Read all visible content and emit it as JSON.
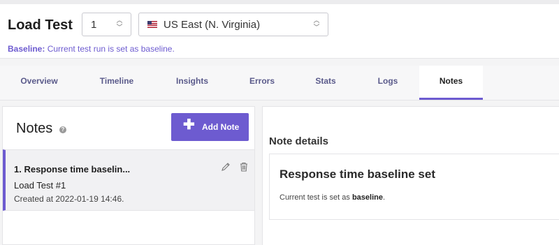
{
  "header": {
    "title": "Load Test",
    "run_value": "1",
    "region_value": "US East (N. Virginia)",
    "baseline_label": "Baseline:",
    "baseline_text": "Current test run is set as baseline."
  },
  "tabs": [
    {
      "label": "Overview"
    },
    {
      "label": "Timeline"
    },
    {
      "label": "Insights"
    },
    {
      "label": "Errors"
    },
    {
      "label": "Stats"
    },
    {
      "label": "Logs"
    },
    {
      "label": "Notes",
      "active": true
    }
  ],
  "notes_panel": {
    "title": "Notes",
    "help": "?",
    "add_button": "Add Note",
    "items": [
      {
        "title": "1. Response time baselin...",
        "test": "Load Test #1",
        "created": "Created at 2022-01-19 14:46."
      }
    ]
  },
  "details": {
    "label": "Note details",
    "card_title": "Response time baseline set",
    "card_text_prefix": "Current test is set as ",
    "card_text_bold": "baseline",
    "card_text_suffix": "."
  },
  "colors": {
    "accent": "#6d5bd0"
  },
  "icons": [
    "help-icon",
    "plus-icon",
    "pencil-icon",
    "trash-icon",
    "chevron-updown-icon",
    "us-flag-icon"
  ]
}
